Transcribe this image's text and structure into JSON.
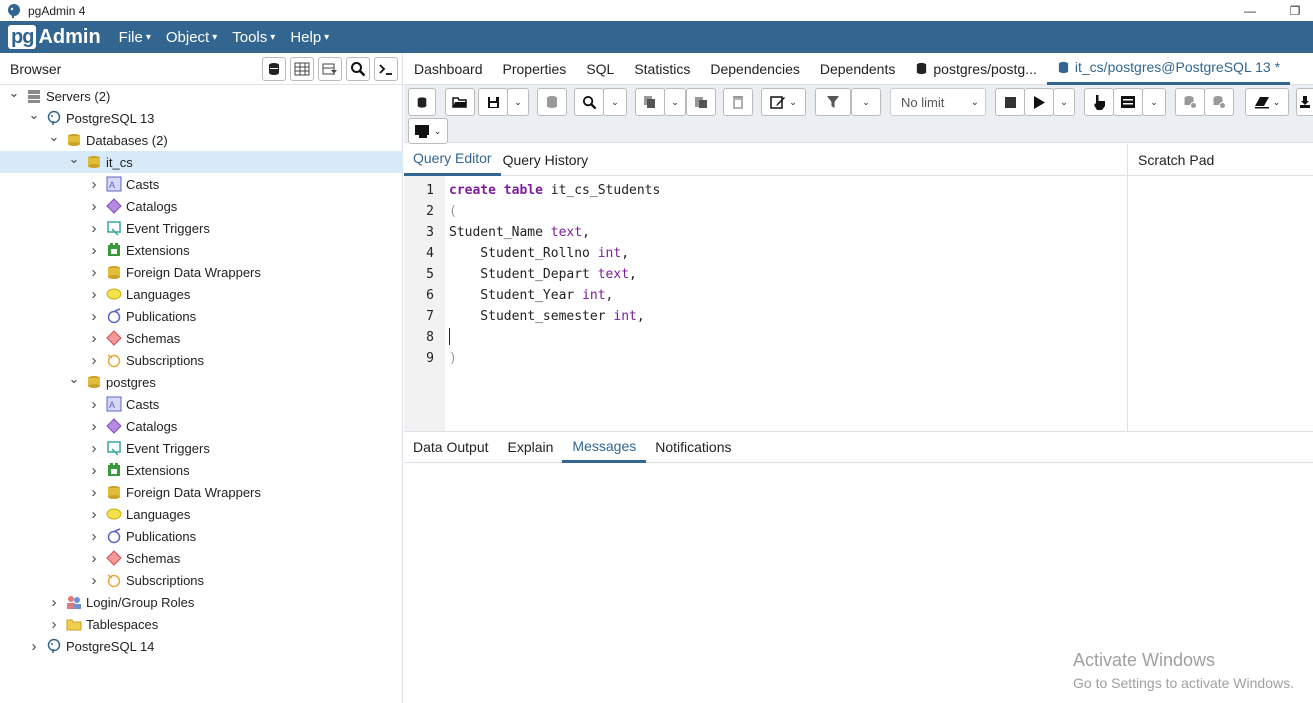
{
  "window": {
    "title": "pgAdmin 4",
    "minimize": "—",
    "restore": "❐"
  },
  "menubar": {
    "logo_pg": "pg",
    "logo_admin": "Admin",
    "items": [
      {
        "label": "File"
      },
      {
        "label": "Object"
      },
      {
        "label": "Tools"
      },
      {
        "label": "Help"
      }
    ]
  },
  "browser": {
    "label": "Browser",
    "tree": [
      {
        "label": "Servers (2)",
        "icon": "servers-icon",
        "level": 0,
        "expanded": true
      },
      {
        "label": "PostgreSQL 13",
        "icon": "elephant-icon",
        "level": 1,
        "expanded": true
      },
      {
        "label": "Databases (2)",
        "icon": "databases-icon",
        "level": 2,
        "expanded": true
      },
      {
        "label": "it_cs",
        "icon": "database-icon",
        "level": 3,
        "expanded": true,
        "selected": true
      },
      {
        "label": "Casts",
        "icon": "casts-icon",
        "level": 4
      },
      {
        "label": "Catalogs",
        "icon": "catalogs-icon",
        "level": 4
      },
      {
        "label": "Event Triggers",
        "icon": "event-triggers-icon",
        "level": 4
      },
      {
        "label": "Extensions",
        "icon": "extensions-icon",
        "level": 4
      },
      {
        "label": "Foreign Data Wrappers",
        "icon": "fdw-icon",
        "level": 4
      },
      {
        "label": "Languages",
        "icon": "languages-icon",
        "level": 4
      },
      {
        "label": "Publications",
        "icon": "publications-icon",
        "level": 4
      },
      {
        "label": "Schemas",
        "icon": "schemas-icon",
        "level": 4
      },
      {
        "label": "Subscriptions",
        "icon": "subscriptions-icon",
        "level": 4
      },
      {
        "label": "postgres",
        "icon": "database-icon",
        "level": 3,
        "expanded": true
      },
      {
        "label": "Casts",
        "icon": "casts-icon",
        "level": 4
      },
      {
        "label": "Catalogs",
        "icon": "catalogs-icon",
        "level": 4
      },
      {
        "label": "Event Triggers",
        "icon": "event-triggers-icon",
        "level": 4
      },
      {
        "label": "Extensions",
        "icon": "extensions-icon",
        "level": 4
      },
      {
        "label": "Foreign Data Wrappers",
        "icon": "fdw-icon",
        "level": 4
      },
      {
        "label": "Languages",
        "icon": "languages-icon",
        "level": 4
      },
      {
        "label": "Publications",
        "icon": "publications-icon",
        "level": 4
      },
      {
        "label": "Schemas",
        "icon": "schemas-icon",
        "level": 4
      },
      {
        "label": "Subscriptions",
        "icon": "subscriptions-icon",
        "level": 4
      },
      {
        "label": "Login/Group Roles",
        "icon": "roles-icon",
        "level": 2
      },
      {
        "label": "Tablespaces",
        "icon": "tablespaces-icon",
        "level": 2
      },
      {
        "label": "PostgreSQL 14",
        "icon": "elephant-icon",
        "level": 1
      }
    ]
  },
  "tabs": {
    "dashboard": "Dashboard",
    "properties": "Properties",
    "sql": "SQL",
    "statistics": "Statistics",
    "dependencies": "Dependencies",
    "dependents": "Dependents",
    "postgres_tab": "postgres/postg...",
    "query_tab": "it_cs/postgres@PostgreSQL 13 *"
  },
  "toolbar": {
    "limit": "No limit"
  },
  "editor": {
    "tabs": {
      "query_editor": "Query Editor",
      "query_history": "Query History"
    },
    "scratch_pad": "Scratch Pad",
    "line_numbers": [
      "1",
      "2",
      "3",
      "4",
      "5",
      "6",
      "7",
      "8",
      "9"
    ],
    "lines": [
      {
        "parts": [
          {
            "t": "create table",
            "c": "kw"
          },
          {
            "t": " it_cs_Students",
            "c": ""
          }
        ]
      },
      {
        "parts": [
          {
            "t": "(",
            "c": "paren"
          }
        ]
      },
      {
        "parts": [
          {
            "t": "Student_Name ",
            "c": ""
          },
          {
            "t": "text",
            "c": "ty"
          },
          {
            "t": ",",
            "c": ""
          }
        ]
      },
      {
        "parts": [
          {
            "t": "    Student_Rollno ",
            "c": ""
          },
          {
            "t": "int",
            "c": "ty"
          },
          {
            "t": ",",
            "c": ""
          }
        ]
      },
      {
        "parts": [
          {
            "t": "    Student_Depart ",
            "c": ""
          },
          {
            "t": "text",
            "c": "ty"
          },
          {
            "t": ",",
            "c": ""
          }
        ]
      },
      {
        "parts": [
          {
            "t": "    Student_Year ",
            "c": ""
          },
          {
            "t": "int",
            "c": "ty"
          },
          {
            "t": ",",
            "c": ""
          }
        ]
      },
      {
        "parts": [
          {
            "t": "    Student_semester ",
            "c": ""
          },
          {
            "t": "int",
            "c": "ty"
          },
          {
            "t": ",",
            "c": ""
          }
        ]
      },
      {
        "parts": []
      },
      {
        "parts": [
          {
            "t": ")",
            "c": "paren"
          }
        ]
      }
    ]
  },
  "output_tabs": {
    "data_output": "Data Output",
    "explain": "Explain",
    "messages": "Messages",
    "notifications": "Notifications"
  },
  "watermark": {
    "line1": "Activate Windows",
    "line2": "Go to Settings to activate Windows."
  },
  "colors": {
    "brand": "#326690",
    "selected_row": "#d8eaf7",
    "keyword": "#7c1d9c"
  }
}
